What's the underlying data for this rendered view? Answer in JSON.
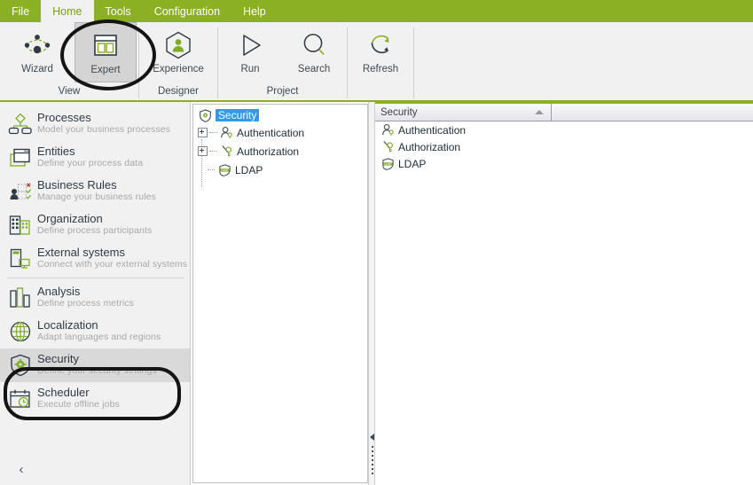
{
  "menu": {
    "items": [
      {
        "label": "File",
        "active": false
      },
      {
        "label": "Home",
        "active": true
      },
      {
        "label": "Tools",
        "active": false
      },
      {
        "label": "Configuration",
        "active": false
      },
      {
        "label": "Help",
        "active": false
      }
    ]
  },
  "ribbon": {
    "groups": [
      {
        "label": "View",
        "buttons": [
          {
            "label": "Wizard",
            "icon": "wizard-icon",
            "selected": false
          },
          {
            "label": "Expert",
            "icon": "expert-icon",
            "selected": true
          }
        ]
      },
      {
        "label": "Designer",
        "buttons": [
          {
            "label": "Experience",
            "icon": "experience-icon",
            "selected": false
          }
        ]
      },
      {
        "label": "Project",
        "buttons": [
          {
            "label": "Run",
            "icon": "run-icon",
            "selected": false
          },
          {
            "label": "Search",
            "icon": "search-icon",
            "selected": false
          }
        ]
      },
      {
        "label": "",
        "buttons": [
          {
            "label": "Refresh",
            "icon": "refresh-icon",
            "selected": false
          }
        ]
      }
    ]
  },
  "sidebar": {
    "items": [
      {
        "title": "Processes",
        "subtitle": "Model your business processes",
        "icon": "processes-icon",
        "active": false
      },
      {
        "title": "Entities",
        "subtitle": "Define your process data",
        "icon": "entities-icon",
        "active": false
      },
      {
        "title": "Business Rules",
        "subtitle": "Manage your business rules",
        "icon": "rules-icon",
        "active": false
      },
      {
        "title": "Organization",
        "subtitle": "Define process participants",
        "icon": "organization-icon",
        "active": false
      },
      {
        "title": "External systems",
        "subtitle": "Connect with your external systems",
        "icon": "external-icon",
        "active": false
      },
      {
        "title": "Analysis",
        "subtitle": "Define process metrics",
        "icon": "analysis-icon",
        "active": false
      },
      {
        "title": "Localization",
        "subtitle": "Adapt languages and regions",
        "icon": "localization-icon",
        "active": false
      },
      {
        "title": "Security",
        "subtitle": "Define your security settings",
        "icon": "security-icon",
        "active": true
      },
      {
        "title": "Scheduler",
        "subtitle": "Execute offline jobs",
        "icon": "scheduler-icon",
        "active": false
      }
    ],
    "collapse_label": "‹"
  },
  "tree": {
    "root": {
      "label": "Security",
      "icon": "security-shield-icon",
      "selected": true
    },
    "nodes": [
      {
        "label": "Authentication",
        "icon": "authentication-icon",
        "expandable": true
      },
      {
        "label": "Authorization",
        "icon": "authorization-icon",
        "expandable": true
      },
      {
        "label": "LDAP",
        "icon": "ldap-icon",
        "expandable": false
      }
    ]
  },
  "list": {
    "columns": [
      {
        "label": "Security",
        "sort": "asc"
      },
      {
        "label": ""
      }
    ],
    "rows": [
      {
        "label": "Authentication",
        "icon": "authentication-icon"
      },
      {
        "label": "Authorization",
        "icon": "authorization-icon"
      },
      {
        "label": "LDAP",
        "icon": "ldap-icon"
      }
    ]
  },
  "colors": {
    "brand_green": "#8cb024",
    "icon_green": "#7fae26",
    "dark_blue": "#2e3a45",
    "selection_blue": "#2e9bf0",
    "annotation": "#141414"
  }
}
